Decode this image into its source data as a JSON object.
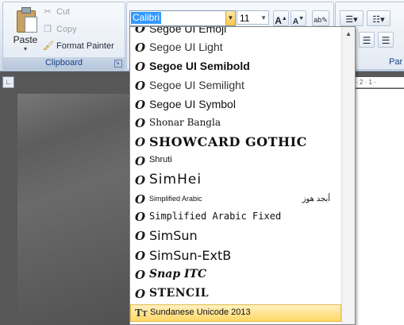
{
  "clipboard": {
    "paste_label": "Paste",
    "paste_arrow": "▾",
    "cut_label": "Cut",
    "copy_label": "Copy",
    "format_painter_label": "Format Painter",
    "group_label": "Clipboard"
  },
  "font": {
    "current_font": "Calibri",
    "current_size": "11",
    "grow_label": "A",
    "shrink_label": "A",
    "clear_icon": "ab-clear-icon"
  },
  "paragraph": {
    "group_label": "Par"
  },
  "ruler": {
    "corner_glyph": "∟",
    "marks": "· 2 · 1 ·"
  },
  "font_list": [
    {
      "name": "Segoe UI Emoji",
      "icon": "opentype"
    },
    {
      "name": "Segoe UI Light",
      "icon": "opentype"
    },
    {
      "name": "Segoe UI Semibold",
      "icon": "opentype"
    },
    {
      "name": "Segoe UI Semilight",
      "icon": "opentype"
    },
    {
      "name": "Segoe UI Symbol",
      "icon": "opentype"
    },
    {
      "name": "Shonar Bangla",
      "icon": "opentype"
    },
    {
      "name": "SHOWCARD GOTHIC",
      "icon": "opentype"
    },
    {
      "name": "Shruti",
      "icon": "opentype"
    },
    {
      "name": "SimHei",
      "icon": "opentype"
    },
    {
      "name": "Simplified Arabic",
      "icon": "opentype",
      "sample": "أبجد هوز"
    },
    {
      "name": "Simplified Arabic Fixed",
      "icon": "opentype"
    },
    {
      "name": "SimSun",
      "icon": "opentype"
    },
    {
      "name": "SimSun-ExtB",
      "icon": "opentype"
    },
    {
      "name": "Snap ITC",
      "icon": "opentype"
    },
    {
      "name": "STENCIL",
      "icon": "opentype"
    },
    {
      "name": "Sundanese Unicode 2013",
      "icon": "truetype",
      "selected": true
    }
  ],
  "colors": {
    "selection_highlight": "#3399ff",
    "hover_gold": "#ffd865",
    "group_label_text": "#15428b"
  }
}
